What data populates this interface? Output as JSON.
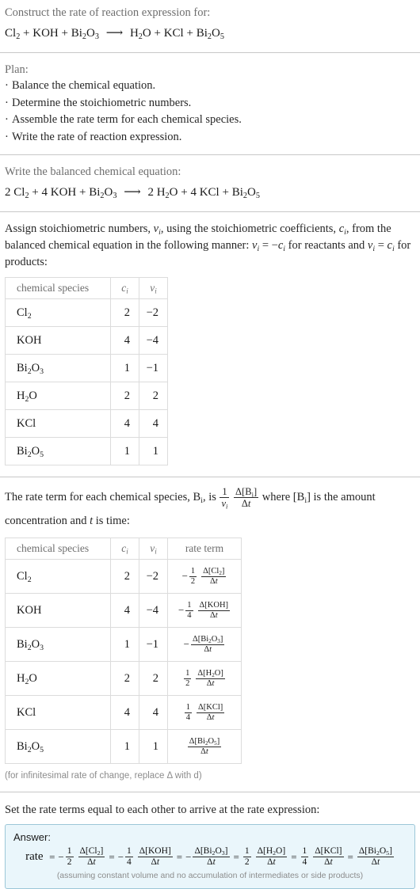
{
  "prompt": {
    "heading": "Construct the rate of reaction expression for:",
    "equation": {
      "reactants": [
        {
          "formula": "Cl2",
          "html": "Cl<sub>2</sub>"
        },
        {
          "formula": "KOH",
          "html": "KOH"
        },
        {
          "formula": "Bi2O3",
          "html": "Bi<sub>2</sub>O<sub>3</sub>"
        }
      ],
      "products": [
        {
          "formula": "H2O",
          "html": "H<sub>2</sub>O"
        },
        {
          "formula": "KCl",
          "html": "KCl"
        },
        {
          "formula": "Bi2O5",
          "html": "Bi<sub>2</sub>O<sub>5</sub>"
        }
      ],
      "arrow": "⟶",
      "text": "Cl2 + KOH + Bi2O3 ⟶ H2O + KCl + Bi2O5"
    }
  },
  "plan": {
    "heading": "Plan:",
    "steps": [
      "Balance the chemical equation.",
      "Determine the stoichiometric numbers.",
      "Assemble the rate term for each chemical species.",
      "Write the rate of reaction expression."
    ]
  },
  "balanced": {
    "heading": "Write the balanced chemical equation:",
    "text": "2 Cl2 + 4 KOH + Bi2O3 ⟶ 2 H2O + 4 KCl + Bi2O5",
    "reactants": [
      {
        "coef": "2",
        "html": "Cl<sub>2</sub>"
      },
      {
        "coef": "4",
        "html": "KOH"
      },
      {
        "coef": "",
        "html": "Bi<sub>2</sub>O<sub>3</sub>"
      }
    ],
    "products": [
      {
        "coef": "2",
        "html": "H<sub>2</sub>O"
      },
      {
        "coef": "4",
        "html": "KCl"
      },
      {
        "coef": "",
        "html": "Bi<sub>2</sub>O<sub>5</sub>"
      }
    ],
    "arrow": "⟶"
  },
  "stoich": {
    "paragraph": "Assign stoichiometric numbers, νi, using the stoichiometric coefficients, ci, from the balanced chemical equation in the following manner: νi = -ci for reactants and νi = ci for products:",
    "table": {
      "headers": [
        "chemical species",
        "c_i",
        "ν_i"
      ],
      "rows": [
        {
          "species_html": "Cl<sub>2</sub>",
          "species": "Cl2",
          "c": "2",
          "v": "−2"
        },
        {
          "species_html": "KOH",
          "species": "KOH",
          "c": "4",
          "v": "−4"
        },
        {
          "species_html": "Bi<sub>2</sub>O<sub>3</sub>",
          "species": "Bi2O3",
          "c": "1",
          "v": "−1"
        },
        {
          "species_html": "H<sub>2</sub>O",
          "species": "H2O",
          "c": "2",
          "v": "2"
        },
        {
          "species_html": "KCl",
          "species": "KCl",
          "c": "4",
          "v": "4"
        },
        {
          "species_html": "Bi<sub>2</sub>O<sub>5</sub>",
          "species": "Bi2O5",
          "c": "1",
          "v": "1"
        }
      ]
    }
  },
  "rateterm": {
    "paragraph_pre": "The rate term for each chemical species, B",
    "paragraph_text": "The rate term for each chemical species, Bi, is 1/νi Δ[Bi]/Δt where [Bi] is the amount concentration and t is time:",
    "table": {
      "headers": [
        "chemical species",
        "c_i",
        "ν_i",
        "rate term"
      ],
      "rows": [
        {
          "species_html": "Cl<sub>2</sub>",
          "species": "Cl2",
          "c": "2",
          "v": "−2",
          "sign": "−",
          "coef_num": "1",
          "coef_den": "2",
          "delta_num": "Δ[Cl<sub>2</sub>]",
          "delta_den": "Δt"
        },
        {
          "species_html": "KOH",
          "species": "KOH",
          "c": "4",
          "v": "−4",
          "sign": "−",
          "coef_num": "1",
          "coef_den": "4",
          "delta_num": "Δ[KOH]",
          "delta_den": "Δt"
        },
        {
          "species_html": "Bi<sub>2</sub>O<sub>3</sub>",
          "species": "Bi2O3",
          "c": "1",
          "v": "−1",
          "sign": "−",
          "coef_num": "",
          "coef_den": "",
          "delta_num": "Δ[Bi<sub>2</sub>O<sub>3</sub>]",
          "delta_den": "Δt"
        },
        {
          "species_html": "H<sub>2</sub>O",
          "species": "H2O",
          "c": "2",
          "v": "2",
          "sign": "",
          "coef_num": "1",
          "coef_den": "2",
          "delta_num": "Δ[H<sub>2</sub>O]",
          "delta_den": "Δt"
        },
        {
          "species_html": "KCl",
          "species": "KCl",
          "c": "4",
          "v": "4",
          "sign": "",
          "coef_num": "1",
          "coef_den": "4",
          "delta_num": "Δ[KCl]",
          "delta_den": "Δt"
        },
        {
          "species_html": "Bi<sub>2</sub>O<sub>5</sub>",
          "species": "Bi2O5",
          "c": "1",
          "v": "1",
          "sign": "",
          "coef_num": "",
          "coef_den": "",
          "delta_num": "Δ[Bi<sub>2</sub>O<sub>5</sub>]",
          "delta_den": "Δt"
        }
      ]
    },
    "footnote": "(for infinitesimal rate of change, replace Δ with d)"
  },
  "final": {
    "heading": "Set the rate terms equal to each other to arrive at the rate expression:",
    "answer_label": "Answer:",
    "rate_label": "rate",
    "equals": "=",
    "expression_text": "rate = -1/2 Δ[Cl2]/Δt = -1/4 Δ[KOH]/Δt = -Δ[Bi2O3]/Δt = 1/2 Δ[H2O]/Δt = 1/4 Δ[KCl]/Δt = Δ[Bi2O5]/Δt",
    "terms": [
      {
        "sign": "−",
        "coef_num": "1",
        "coef_den": "2",
        "delta_num": "Δ[Cl<sub>2</sub>]",
        "delta_den": "Δt"
      },
      {
        "sign": "−",
        "coef_num": "1",
        "coef_den": "4",
        "delta_num": "Δ[KOH]",
        "delta_den": "Δt"
      },
      {
        "sign": "−",
        "coef_num": "",
        "coef_den": "",
        "delta_num": "Δ[Bi<sub>2</sub>O<sub>3</sub>]",
        "delta_den": "Δt"
      },
      {
        "sign": "",
        "coef_num": "1",
        "coef_den": "2",
        "delta_num": "Δ[H<sub>2</sub>O]",
        "delta_den": "Δt"
      },
      {
        "sign": "",
        "coef_num": "1",
        "coef_den": "4",
        "delta_num": "Δ[KCl]",
        "delta_den": "Δt"
      },
      {
        "sign": "",
        "coef_num": "",
        "coef_den": "",
        "delta_num": "Δ[Bi<sub>2</sub>O<sub>5</sub>]",
        "delta_den": "Δt"
      }
    ],
    "assumption": "(assuming constant volume and no accumulation of intermediates or side products)"
  },
  "colors": {
    "answer_background": "#eaf6fb",
    "answer_border": "#9cc7d8",
    "divider": "#9a9a9a",
    "table_border": "#dcdcdc",
    "muted_text": "#6e6e6e"
  }
}
